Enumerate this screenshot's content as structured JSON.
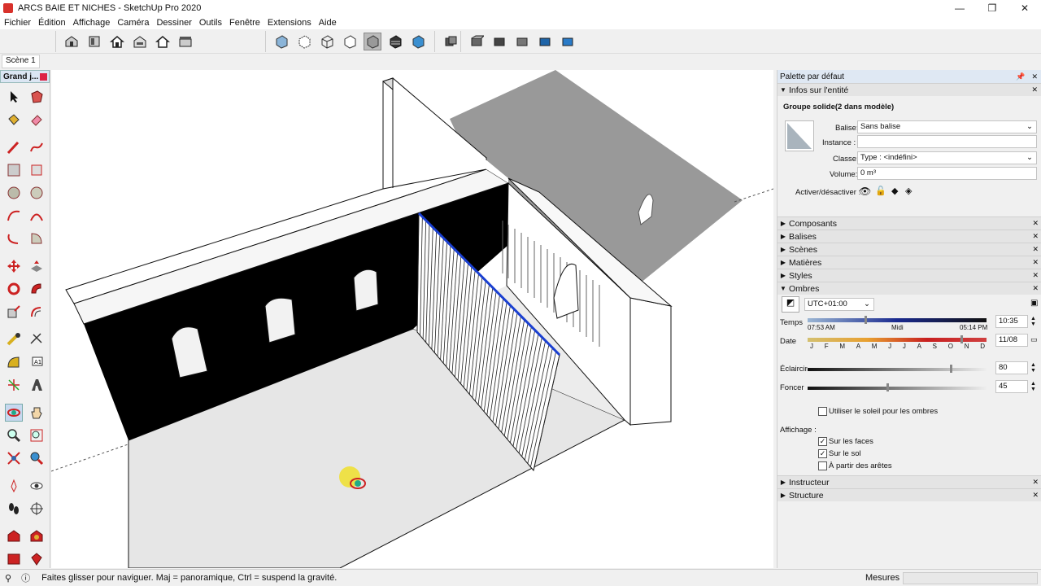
{
  "window": {
    "title": "ARCS BAIE ET NICHES - SketchUp Pro 2020",
    "minimize": "—",
    "maximize": "❐",
    "close": "✕"
  },
  "menu": [
    "Fichier",
    "Édition",
    "Affichage",
    "Caméra",
    "Dessiner",
    "Outils",
    "Fenêtre",
    "Extensions",
    "Aide"
  ],
  "scene_tab": "Scène 1",
  "left_tray": {
    "title": "Grand j..."
  },
  "panel": {
    "title": "Palette par défaut",
    "entity_section": "Infos sur l'entité",
    "entity_name": "Groupe solide(2 dans modèle)",
    "balise_label": "Balise:",
    "balise_value": "Sans balise",
    "instance_label": "Instance :",
    "instance_value": "",
    "classe_label": "Classe:",
    "classe_value": "Type : <indéfini>",
    "volume_label": "Volume:",
    "volume_value": "0 m³",
    "toggle_label": "Activer/désactiver :",
    "sections": [
      "Composants",
      "Balises",
      "Scènes",
      "Matières",
      "Styles"
    ],
    "shadows": {
      "title": "Ombres",
      "timezone": "UTC+01:00",
      "time_label": "Temps",
      "sunrise": "07:53 AM",
      "noon": "Midi",
      "sunset": "05:14 PM",
      "time_value": "10:35",
      "date_label": "Date",
      "months": [
        "J",
        "F",
        "M",
        "A",
        "M",
        "J",
        "J",
        "A",
        "S",
        "O",
        "N",
        "D"
      ],
      "date_value": "11/08",
      "light_label": "Éclaircir",
      "light_value": "80",
      "dark_label": "Foncer",
      "dark_value": "45",
      "sun_checkbox": "Utiliser le soleil pour les ombres",
      "display_label": "Affichage :",
      "on_faces": "Sur les faces",
      "on_ground": "Sur le sol",
      "from_edges": "À partir des arêtes"
    },
    "bottom_sections": [
      "Instructeur",
      "Structure"
    ]
  },
  "status": {
    "hint": "Faites glisser pour naviguer. Maj = panoramique, Ctrl =  suspend la gravité.",
    "measure_label": "Mesures"
  },
  "colors": {
    "accent_blue": "#1a3fd0",
    "panel_header": "#dfe8f3"
  }
}
